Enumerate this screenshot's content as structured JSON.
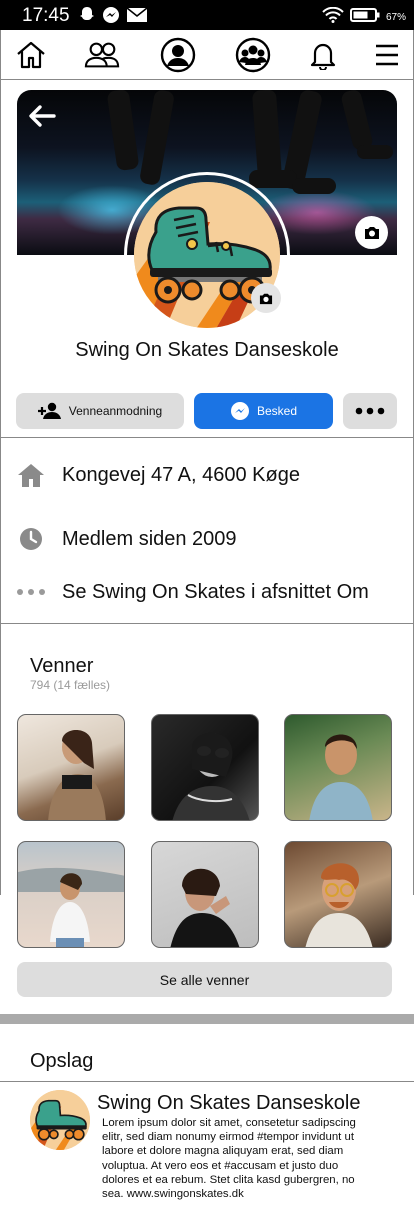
{
  "status_bar": {
    "time": "17:45",
    "battery": "67%",
    "icons": [
      "snapchat-icon",
      "messenger-icon",
      "mail-icon",
      "wifi-icon",
      "battery-icon"
    ]
  },
  "nav": {
    "items": [
      "home-icon",
      "friends-icon",
      "profile-icon",
      "groups-icon",
      "bell-icon",
      "menu-icon"
    ]
  },
  "profile": {
    "name": "Swing On Skates Danseskole",
    "friend_button": "Venneanmodning",
    "message_button": "Besked",
    "more_button": "•••"
  },
  "info": {
    "address": "Kongevej 47 A, 4600 Køge",
    "member_since": "Medlem siden 2009",
    "about_link": "Se Swing On Skates i afsnittet Om"
  },
  "friends": {
    "title": "Venner",
    "subtitle": "794 (14 fælles)",
    "see_all": "Se alle venner"
  },
  "posts": {
    "title": "Opslag",
    "author": "Swing On Skates Danseskole",
    "body": "Lorem ipsum dolor sit amet, consetetur sadipscing elitr, sed diam nonumy eirmod #tempor invidunt ut labore et dolore magna aliquyam erat, sed diam voluptua. At vero eos et #accusam et justo duo dolores et ea rebum. Stet clita kasd gubergren, no sea. www.swingonskates.dk"
  },
  "colors": {
    "accent": "#1b74e4",
    "button_grey": "#dddddd",
    "divider": "#888888"
  }
}
